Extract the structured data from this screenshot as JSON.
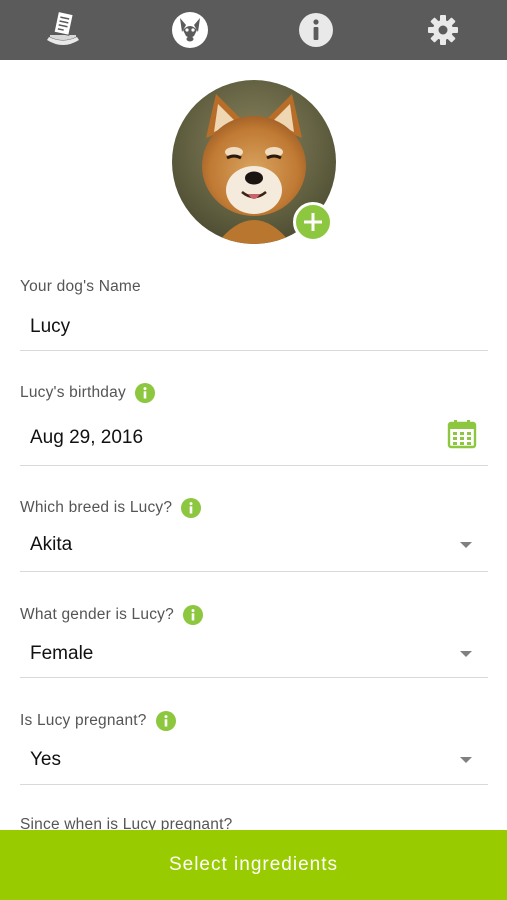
{
  "colors": {
    "accent": "#8dc63f",
    "cta": "#99cc00",
    "topbar": "#5b5b5b"
  },
  "tabs": [
    {
      "icon": "recipe-bowl-icon"
    },
    {
      "icon": "dog-face-icon",
      "active": true
    },
    {
      "icon": "info-icon"
    },
    {
      "icon": "gear-icon"
    }
  ],
  "profile": {
    "photo": "shiba-inu-photo",
    "add_photo_icon": "plus-icon"
  },
  "form": {
    "name": {
      "label": "Your dog's Name",
      "value": "Lucy"
    },
    "birthday": {
      "label": "Lucy's birthday",
      "value": "Aug 29, 2016"
    },
    "breed": {
      "label": "Which breed is Lucy?",
      "value": "Akita"
    },
    "gender": {
      "label": "What gender is Lucy?",
      "value": "Female"
    },
    "pregnant": {
      "label": "Is Lucy pregnant?",
      "value": "Yes"
    },
    "since_pregnant": {
      "label": "Since when is Lucy pregnant?"
    }
  },
  "cta": {
    "label": "Select ingredients"
  }
}
